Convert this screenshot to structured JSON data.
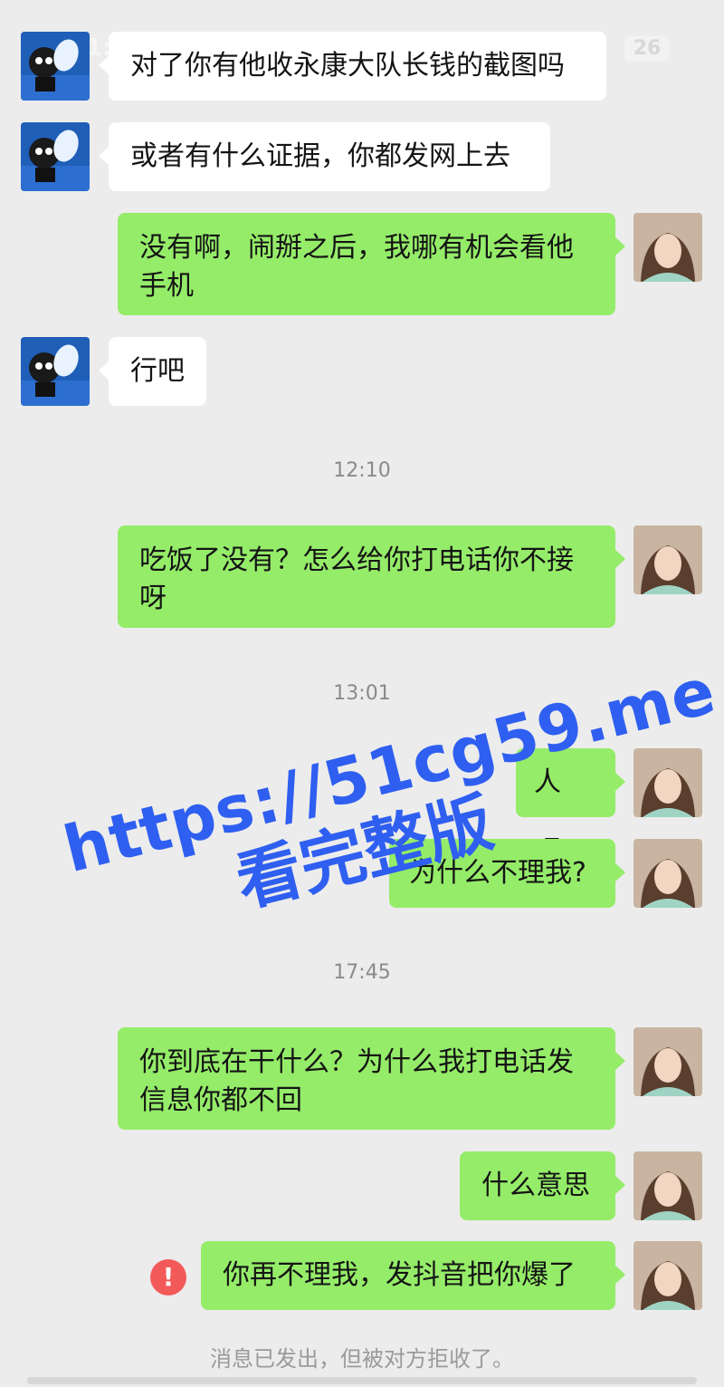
{
  "status_bar": {
    "time_partial": "1:",
    "badge": "26"
  },
  "messages": [
    {
      "id": "m1",
      "side": "in",
      "text": "对了你有他收永康大队长钱的截图吗"
    },
    {
      "id": "m2",
      "side": "in",
      "text": "或者有什么证据，你都发网上去"
    },
    {
      "id": "m3",
      "side": "out",
      "text": "没有啊，闹掰之后，我哪有机会看他手机"
    },
    {
      "id": "m4",
      "side": "in",
      "text": "行吧"
    },
    {
      "id": "m5",
      "side": "out",
      "text": "吃饭了没有？怎么给你打电话你不接呀"
    },
    {
      "id": "m6",
      "side": "out",
      "text": "人呢?"
    },
    {
      "id": "m7",
      "side": "out",
      "text": "为什么不理我?"
    },
    {
      "id": "m8",
      "side": "out",
      "text": "你到底在干什么？为什么我打电话发信息你都不回"
    },
    {
      "id": "m9",
      "side": "out",
      "text": "什么意思"
    },
    {
      "id": "m10",
      "side": "out",
      "text": "你再不理我，发抖音把你爆了",
      "failed": true
    }
  ],
  "timestamps": [
    "12:10",
    "13:01",
    "17:45"
  ],
  "error_icon_glyph": "!",
  "system_note": "消息已发出，但被对方拒收了。",
  "watermark": {
    "line1": "https://51cg59.me",
    "line2": "看完整版"
  },
  "colors": {
    "background": "#ececec",
    "outgoing_bubble": "#95ec69",
    "incoming_bubble": "#ffffff",
    "watermark": "#2f5ff0",
    "error": "#f25a5a"
  }
}
